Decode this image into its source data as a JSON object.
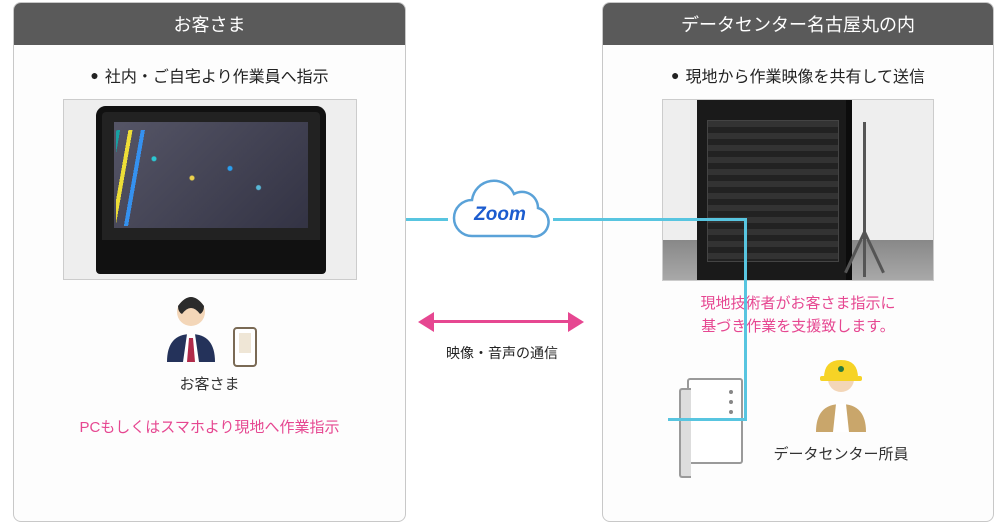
{
  "left": {
    "title": "お客さま",
    "bullet": "社内・ご自宅より作業員へ指示",
    "customer_label": "お客さま",
    "bottom_text": "PCもしくはスマホより現地へ作業指示"
  },
  "right": {
    "title": "データセンター名古屋丸の内",
    "bullet": "現地から作業映像を共有して送信",
    "desc_line1": "現地技術者がお客さま指示に",
    "desc_line2": "基づき作業を支援致します。",
    "staff_label": "データセンター所員"
  },
  "center": {
    "cloud_label": "Zoom",
    "conn_label": "映像・音声の通信"
  }
}
